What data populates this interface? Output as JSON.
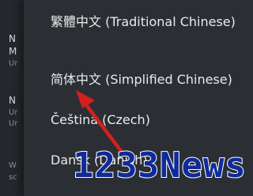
{
  "background_settings": {
    "stubs": [
      {
        "title": "N",
        "sub": ""
      },
      {
        "title": "M",
        "sub": "Ur"
      },
      {
        "title": "N",
        "sub": "Ur"
      },
      {
        "title": "",
        "sub": "Ur"
      },
      {
        "title": "",
        "sub": "W"
      },
      {
        "title": "",
        "sub": "sc"
      }
    ]
  },
  "language_dialog": {
    "options": [
      {
        "label": "繁體中文 (Traditional Chinese)"
      },
      {
        "label": "简体中文 (Simplified Chinese)"
      },
      {
        "label": "Čeština (Czech)"
      },
      {
        "label": "Dansk (Danish)"
      }
    ]
  },
  "watermark": {
    "text": "1233News"
  },
  "colors": {
    "dialog_bg": "#2b2f33",
    "arrow": "#d51f1f",
    "watermark": "#0f2a9a",
    "accent_green": "#3ec46d"
  }
}
